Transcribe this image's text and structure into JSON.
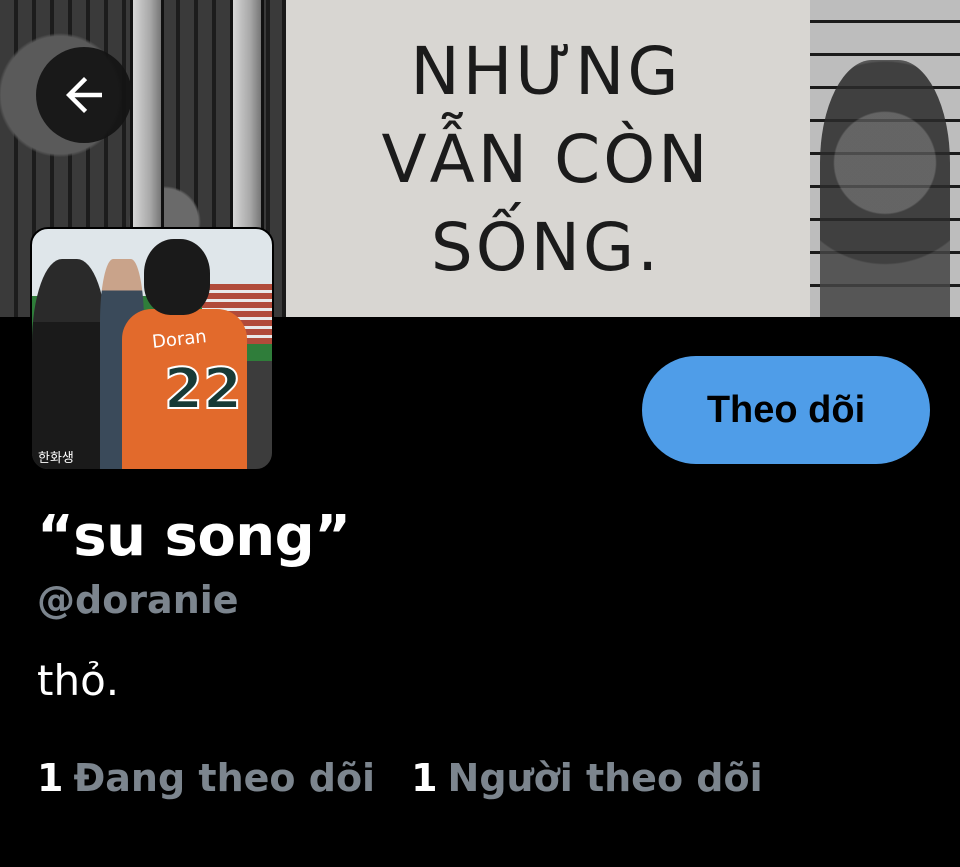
{
  "banner": {
    "caption": "NHƯNG\nVẪN CÒN\nSỐNG."
  },
  "header": {
    "back_icon": "arrow-left-icon"
  },
  "avatar": {
    "jersey_name": "Doran",
    "jersey_number": "22",
    "sleeve_text": "한화생"
  },
  "actions": {
    "follow_label": "Theo dõi",
    "follow_color": "#4f9de8"
  },
  "profile": {
    "display_name": "“su song”",
    "handle": "@doranie",
    "bio": "thỏ."
  },
  "stats": {
    "following_count": "1",
    "following_label": "Đang theo dõi",
    "followers_count": "1",
    "followers_label": "Người theo dõi",
    "muted_color": "#7c858e"
  }
}
